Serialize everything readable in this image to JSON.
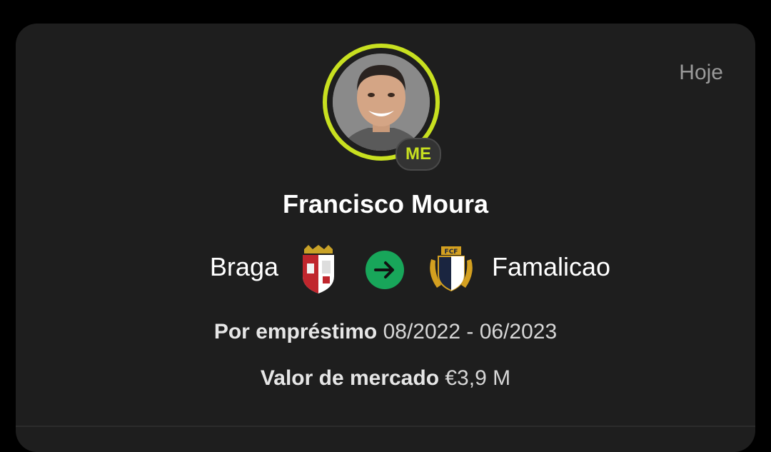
{
  "date_label": "Hoje",
  "player": {
    "name": "Francisco Moura",
    "badge": "ME"
  },
  "transfer": {
    "from_club": "Braga",
    "to_club": "Famalicao",
    "from_crest_icon": "braga-crest-icon",
    "to_crest_icon": "famalicao-crest-icon",
    "arrow_icon": "arrow-right-icon"
  },
  "details": {
    "loan_label": "Por empréstimo",
    "loan_period": "08/2022 - 06/2023",
    "market_value_label": "Valor de mercado",
    "market_value": "€3,9 M"
  },
  "colors": {
    "accent_ring": "#c8e020",
    "arrow_bg": "#18a65a",
    "card_bg": "#1e1e1e"
  }
}
